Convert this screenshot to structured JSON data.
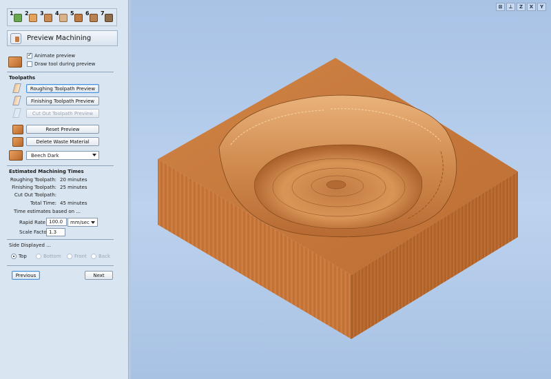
{
  "steps": [
    {
      "num": "1",
      "icon": "setup-icon",
      "color": "#6aa84f"
    },
    {
      "num": "2",
      "icon": "vector-icon",
      "color": "#e2a35c"
    },
    {
      "num": "3",
      "icon": "model-icon",
      "color": "#c98a54"
    },
    {
      "num": "4",
      "icon": "toolpath-icon",
      "color": "#d8b38a"
    },
    {
      "num": "5",
      "icon": "roughing-icon",
      "color": "#c07a44"
    },
    {
      "num": "6",
      "icon": "preview-icon",
      "color": "#b98252"
    },
    {
      "num": "7",
      "icon": "save-icon",
      "color": "#8f6d4a"
    }
  ],
  "panel": {
    "title": "Preview Machining",
    "animate_preview": "Animate preview",
    "draw_tool": "Draw tool during preview",
    "toolpaths_heading": "Toolpaths",
    "roughing_btn": "Roughing Toolpath Preview",
    "finishing_btn": "Finishing Toolpath Preview",
    "cutout_btn": "Cut Out Toolpath Preview",
    "reset_btn": "Reset Preview",
    "delete_btn": "Delete Waste Material",
    "material": "Beech Dark",
    "times_heading": "Estimated Machining Times",
    "roughing_label": "Roughing Toolpath:",
    "roughing_val": "20 minutes",
    "finishing_label": "Finishing Toolpath:",
    "finishing_val": "25 minutes",
    "cutout_label": "Cut Out Toolpath:",
    "cutout_val": "",
    "total_label": "Total Time:",
    "total_val": "45 minutes",
    "estimates_note": "Time estimates based on ...",
    "rapid_label": "Rapid Rate",
    "rapid_val": "100.0",
    "rapid_unit": "mm/sec",
    "scale_label": "Scale Factor",
    "scale_val": "1.3",
    "side_heading": "Side Displayed ...",
    "side_top": "Top",
    "side_bottom": "Bottom",
    "side_front": "Front",
    "side_back": "Back",
    "previous_btn": "Previous",
    "next_btn": "Next"
  },
  "view_toolbar": {
    "fit": "⊠",
    "iso": "⊥",
    "z": "Z",
    "x": "X",
    "y": "Y"
  },
  "colors": {
    "wood_top": "#c77a3e",
    "wood_front": "#c8773a",
    "wood_side": "#b3652b",
    "pocket": "#d99558",
    "sky": "#b5cdec"
  }
}
